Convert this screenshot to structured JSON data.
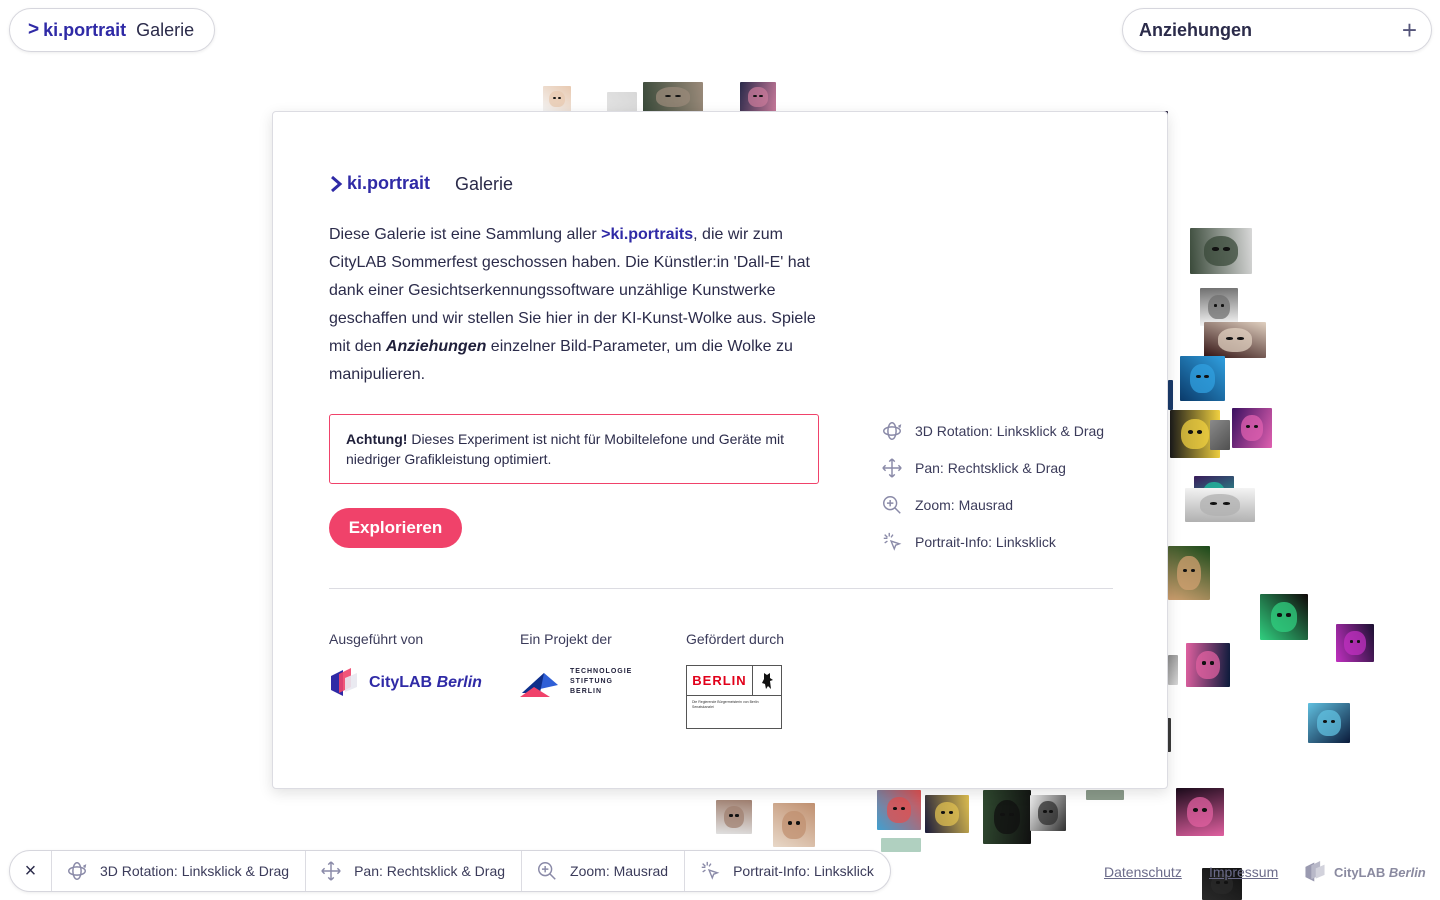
{
  "app": {
    "brand_prefix": ">",
    "brand_name": "ki.portrait",
    "brand_section": "Galerie"
  },
  "top_right": {
    "label": "Anziehungen",
    "plus": "+"
  },
  "modal": {
    "brand_name": "ki.portrait",
    "brand_section": "Galerie",
    "intro": {
      "p1": "Diese Galerie ist eine Sammlung aller ",
      "highlight": ">ki.portraits",
      "p2": ", die wir zum CityLAB Sommerfest geschossen haben. Die Künstler:in 'Dall-E' hat dank einer Gesichtserkennungssoftware unzählige Kunstwerke geschaffen und wir stellen Sie hier in der KI-Kunst-Wolke aus. Spiele mit den ",
      "emph": "Anziehungen",
      "p3": " einzelner Bild-Parameter, um die Wolke zu manipulieren."
    },
    "warning": {
      "strong": "Achtung!",
      "text": " Dieses Experiment ist nicht für Mobiltelefone und Geräte mit niedriger Grafikleistung optimiert."
    },
    "explore_button": "Explorieren",
    "hints": [
      {
        "icon": "rotate-3d-icon",
        "label": "3D Rotation: Linksklick & Drag"
      },
      {
        "icon": "pan-icon",
        "label": "Pan: Rechtsklick & Drag"
      },
      {
        "icon": "zoom-icon",
        "label": "Zoom: Mausrad"
      },
      {
        "icon": "click-icon",
        "label": "Portrait-Info: Linksklick"
      }
    ],
    "credits": {
      "executed_by": "Ausgeführt von",
      "project_of": "Ein Projekt der",
      "funded_by": "Gefördert durch",
      "citylab_name": "CityLAB",
      "citylab_city": "Berlin",
      "tsb_lines": [
        "TECHNOLOGIE",
        "STIFTUNG",
        "BERLIN"
      ],
      "berlin_word": "BERLIN",
      "berlin_small": "Die Regierende Bürgermeisterin von Berlin Senatskanzlei"
    }
  },
  "bottom_bar": {
    "close": "×",
    "items": [
      {
        "icon": "rotate-3d-icon",
        "label": "3D Rotation: Linksklick & Drag"
      },
      {
        "icon": "pan-icon",
        "label": "Pan: Rechtsklick & Drag"
      },
      {
        "icon": "zoom-icon",
        "label": "Zoom: Mausrad"
      },
      {
        "icon": "click-icon",
        "label": "Portrait-Info: Linksklick"
      }
    ]
  },
  "footer": {
    "privacy": "Datenschutz",
    "imprint": "Impressum",
    "logo_name": "CityLAB",
    "logo_city": "Berlin"
  },
  "colors": {
    "brand": "#2f2aa6",
    "accent": "#f0426a",
    "text": "#2b2b4a"
  }
}
